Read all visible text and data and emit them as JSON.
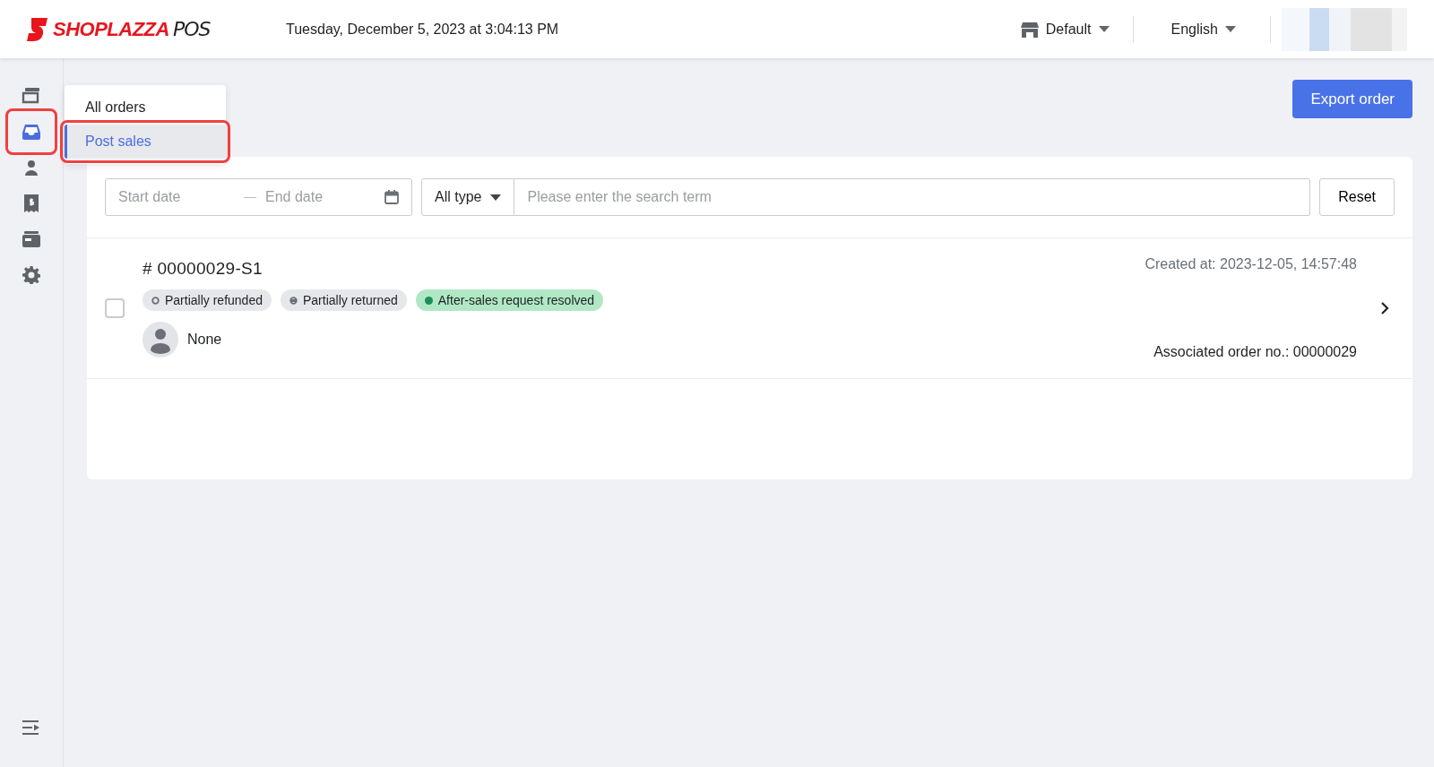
{
  "header": {
    "logo": {
      "brand": "SHOPLAZZA",
      "product": "POS"
    },
    "datetime": "Tuesday, December 5, 2023 at 3:04:13 PM",
    "store": "Default",
    "language": "English"
  },
  "sidebar": {
    "items": [
      {
        "kind": "register",
        "selected": false,
        "highlighted": false
      },
      {
        "kind": "orders",
        "selected": true,
        "highlighted": true
      },
      {
        "kind": "customers",
        "selected": false,
        "highlighted": false
      },
      {
        "kind": "receipt",
        "selected": false,
        "highlighted": false
      },
      {
        "kind": "wallet",
        "selected": false,
        "highlighted": false
      },
      {
        "kind": "settings",
        "selected": false,
        "highlighted": false
      }
    ]
  },
  "submenu": {
    "items": [
      {
        "label": "All orders",
        "selected": false,
        "highlighted": false
      },
      {
        "label": "Post sales",
        "selected": true,
        "highlighted": true
      }
    ]
  },
  "export_button": "Export order",
  "filters": {
    "start_placeholder": "Start date",
    "end_placeholder": "End date",
    "type": "All type",
    "search_placeholder": "Please enter the search term",
    "reset": "Reset"
  },
  "orders": [
    {
      "number": "# 00000029-S1",
      "checked": false,
      "created": "Created at: 2023-12-05, 14:57:48",
      "tags": [
        {
          "label": "Partially refunded",
          "kind": "ring",
          "color": "#6b6f76"
        },
        {
          "label": "Partially returned",
          "kind": "half",
          "color": "#6b6f76"
        },
        {
          "label": "After-sales request resolved",
          "kind": "solid",
          "color": "#1a8f5c"
        }
      ],
      "customer": "None",
      "associated": "Associated order no.: 00000029"
    }
  ]
}
